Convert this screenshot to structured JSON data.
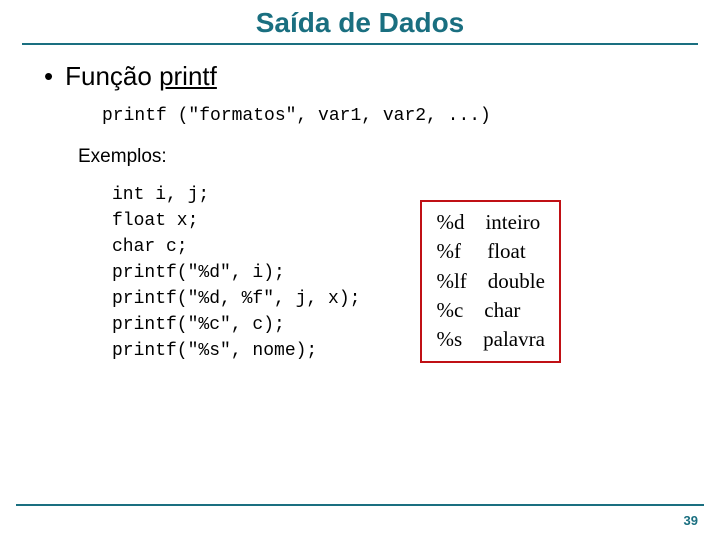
{
  "title": "Saída de Dados",
  "bullet": {
    "prefix": "Função ",
    "underlined": "printf"
  },
  "signature": "printf (\"formatos\", var1, var2, ...)",
  "exemplos_label": "Exemplos:",
  "code": "int i, j;\nfloat x;\nchar c;\nprintf(\"%d\", i);\nprintf(\"%d, %f\", j, x);\nprintf(\"%c\", c);\nprintf(\"%s\", nome);",
  "format_table": [
    {
      "spec": "%d",
      "pad": "    ",
      "desc": "inteiro"
    },
    {
      "spec": "%f",
      "pad": "     ",
      "desc": "float"
    },
    {
      "spec": "%lf",
      "pad": "    ",
      "desc": "double"
    },
    {
      "spec": "%c",
      "pad": "    ",
      "desc": "char"
    },
    {
      "spec": "%s",
      "pad": "    ",
      "desc": "palavra"
    }
  ],
  "page_number": "39"
}
